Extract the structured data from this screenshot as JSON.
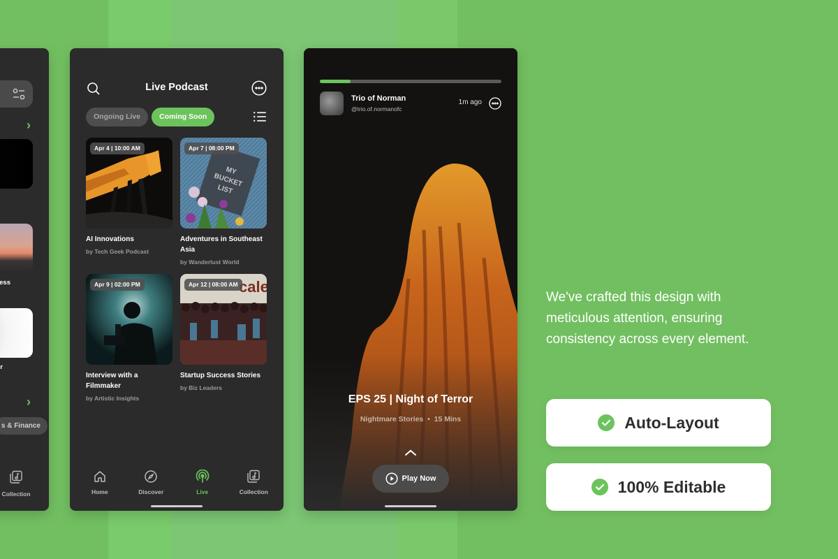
{
  "colors": {
    "accent": "#6cc35c",
    "background": "#72bf61",
    "phone_bg": "#2b2b2b",
    "chip_inactive": "#4e4e4e"
  },
  "left_phone": {
    "filter_icon": "sliders-icon",
    "card_titles": [
      "ess",
      "r"
    ],
    "category_chip": "s & Finance",
    "nav_label": "Collection"
  },
  "live_podcast": {
    "header": {
      "title": "Live Podcast",
      "search_icon": "search-icon",
      "more_icon": "more-horizontal-icon"
    },
    "tabs": [
      {
        "label": "Ongoing Live",
        "active": false
      },
      {
        "label": "Coming Soon",
        "active": true
      }
    ],
    "view_icon": "list-icon",
    "cards": [
      {
        "date": "Apr 4 | 10:00 AM",
        "title": "AI Innovations",
        "by": "by Tech Geek Podcast",
        "image": "robot-dog"
      },
      {
        "date": "Apr 7 | 08:00 PM",
        "title": "Adventures in Southeast Asia",
        "by": "by Wanderlust World",
        "image": "bucket-list-book"
      },
      {
        "date": "Apr 9 | 02:00 PM",
        "title": "Interview with a Filmmaker",
        "by": "by Artistic Insights",
        "image": "filmmaker-silhouette"
      },
      {
        "date": "Apr 12 | 08:00 AM",
        "title": "Startup Success Stories",
        "by": "by Biz Leaders",
        "image": "crowd-event"
      }
    ],
    "bottom_nav": [
      {
        "label": "Home",
        "icon": "home-icon",
        "active": false
      },
      {
        "label": "Discover",
        "icon": "compass-icon",
        "active": false
      },
      {
        "label": "Live",
        "icon": "broadcast-icon",
        "active": true
      },
      {
        "label": "Collection",
        "icon": "music-collection-icon",
        "active": false
      }
    ]
  },
  "story": {
    "progress_percent": 17,
    "author_name": "Trio of Norman",
    "author_handle": "@trio.of.normanofc",
    "time": "1m ago",
    "episode_title": "EPS 25 | Night of Terror",
    "show": "Nightmare Stories",
    "duration": "15 Mins",
    "play_label": "Play Now"
  },
  "promo": {
    "description": "We've crafted this design with meticulous attention, ensuring consistency across every element.",
    "badges": [
      "Auto-Layout",
      "100% Editable"
    ]
  }
}
